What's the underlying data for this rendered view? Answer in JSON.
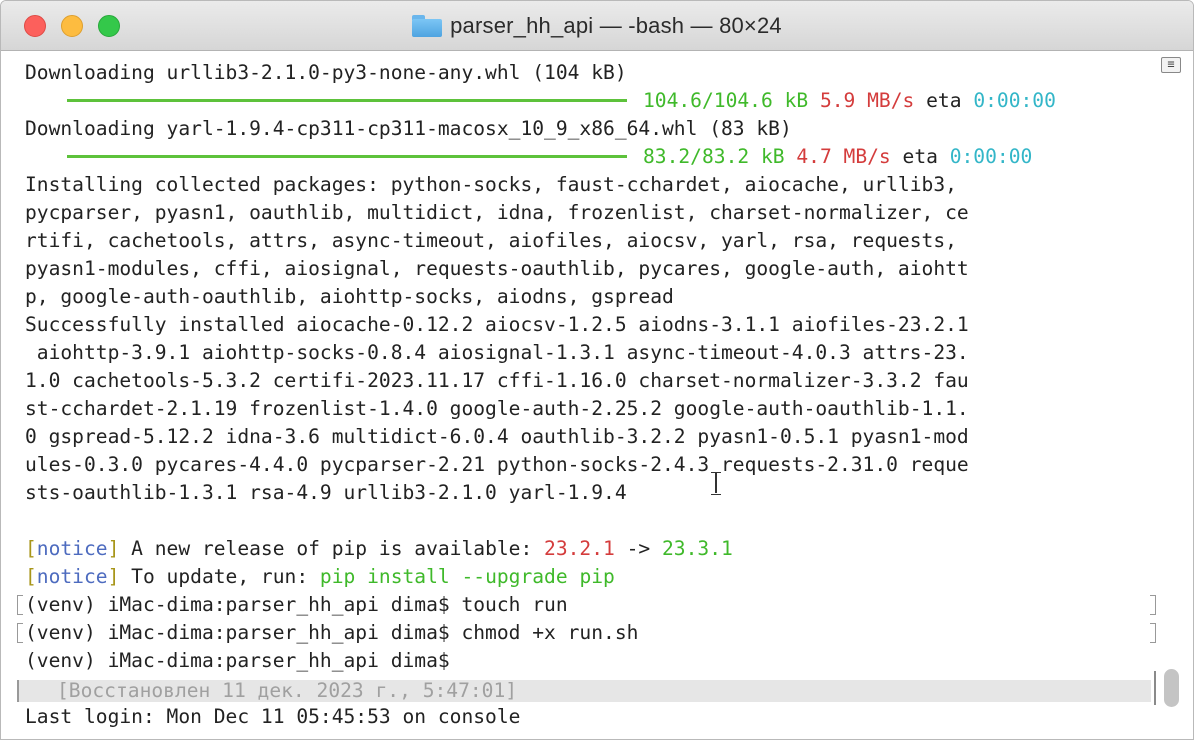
{
  "window": {
    "title": "parser_hh_api — -bash — 80×24"
  },
  "terminal": {
    "lines": [
      "Downloading urllib3-2.1.0-py3-none-any.whl (104 kB)",
      "",
      "Downloading yarl-1.9.4-cp311-cp311-macosx_10_9_x86_64.whl (83 kB)",
      "",
      "Installing collected packages: python-socks, faust-cchardet, aiocache, urllib3,",
      "pycparser, pyasn1, oauthlib, multidict, idna, frozenlist, charset-normalizer, ce",
      "rtifi, cachetools, attrs, async-timeout, aiofiles, aiocsv, yarl, rsa, requests,",
      "pyasn1-modules, cffi, aiosignal, requests-oauthlib, pycares, google-auth, aiohtt",
      "p, google-auth-oauthlib, aiohttp-socks, aiodns, gspread",
      "Successfully installed aiocache-0.12.2 aiocsv-1.2.5 aiodns-3.1.1 aiofiles-23.2.1",
      " aiohttp-3.9.1 aiohttp-socks-0.8.4 aiosignal-1.3.1 async-timeout-4.0.3 attrs-23.",
      "1.0 cachetools-5.3.2 certifi-2023.11.17 cffi-1.16.0 charset-normalizer-3.3.2 fau",
      "st-cchardet-2.1.19 frozenlist-1.4.0 google-auth-2.25.2 google-auth-oauthlib-1.1.",
      "0 gspread-5.12.2 idna-3.6 multidict-6.0.4 oauthlib-3.2.2 pyasn1-0.5.1 pyasn1-mod",
      "ules-0.3.0 pycares-4.4.0 pycparser-2.21 python-socks-2.4.3 requests-2.31.0 reque",
      "sts-oauthlib-1.3.1 rsa-4.9 urllib3-2.1.0 yarl-1.9.4"
    ],
    "progress": [
      {
        "done": "104.6/104.6",
        "unit": "kB",
        "speed": "5.9 MB/s",
        "eta_label": "eta",
        "eta": "0:00:00",
        "fraction": 1.0
      },
      {
        "done": "83.2/83.2",
        "unit": "kB",
        "speed": "4.7 MB/s",
        "eta_label": "eta",
        "eta": "0:00:00",
        "fraction": 1.0
      }
    ],
    "notice1": {
      "open": "[",
      "tag": "notice",
      "close": "]",
      "text": " A new release of pip is available: ",
      "old": "23.2.1",
      "arrow": " -> ",
      "new": "23.3.1"
    },
    "notice2": {
      "open": "[",
      "tag": "notice",
      "close": "]",
      "text": " To update, run: ",
      "cmd": "pip install --upgrade pip"
    },
    "prompts": [
      "(venv) iMac-dima:parser_hh_api dima$ touch run",
      "(venv) iMac-dima:parser_hh_api dima$ chmod +x run.sh",
      "(venv) iMac-dima:parser_hh_api dima$"
    ],
    "restored": "[Восстановлен 11 дек. 2023 г., 5:47:01]",
    "last_login": "Last login: Mon Dec 11 05:45:53 on console"
  },
  "colors": {
    "success_green": "#3fb92a",
    "error_red": "#d43c3c",
    "eta_cyan": "#33b6c8",
    "notice_yellow": "#a8961a",
    "notice_blue": "#4d6bbf"
  }
}
